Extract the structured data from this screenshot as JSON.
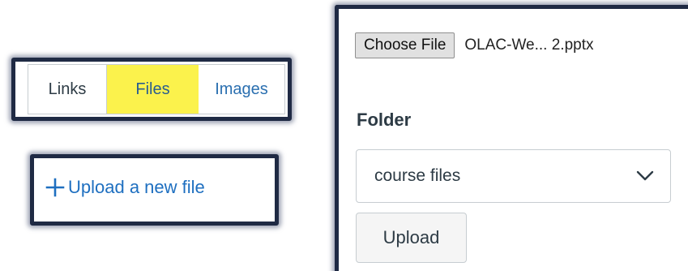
{
  "tabs": {
    "items": [
      {
        "label": "Links"
      },
      {
        "label": "Files"
      },
      {
        "label": "Images"
      }
    ],
    "selected": "Files",
    "highlight_color": "#fbf24c"
  },
  "upload_link": {
    "label": "Upload a new file",
    "icon": "plus-icon",
    "color": "#1e6fc0"
  },
  "upload_panel": {
    "choose_file_label": "Choose File",
    "selected_file_name": "OLAC-We... 2.pptx",
    "folder_label": "Folder",
    "folder_select": {
      "selected": "course files",
      "icon": "chevron-down-icon"
    },
    "upload_button_label": "Upload"
  },
  "frame_color": "#1f2a44"
}
